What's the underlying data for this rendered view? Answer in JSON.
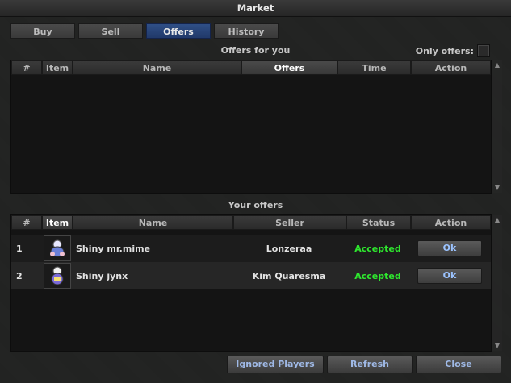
{
  "window": {
    "title": "Market"
  },
  "tabs": [
    {
      "label": "Buy",
      "active": false
    },
    {
      "label": "Sell",
      "active": false
    },
    {
      "label": "Offers",
      "active": true
    },
    {
      "label": "History",
      "active": false
    }
  ],
  "offers_for_you": {
    "title": "Offers for you",
    "only_offers_label": "Only offers:",
    "columns": [
      "#",
      "Item",
      "Name",
      "Offers",
      "Time",
      "Action"
    ],
    "selected_column": "Offers",
    "rows": []
  },
  "your_offers": {
    "title": "Your offers",
    "columns": [
      "#",
      "Item",
      "Name",
      "Seller",
      "Status",
      "Action"
    ],
    "selected_column": "Item",
    "rows": [
      {
        "num": "1",
        "name": "Shiny mr.mime",
        "seller": "Lonzeraa",
        "status": "Accepted",
        "action": "Ok"
      },
      {
        "num": "2",
        "name": "Shiny jynx",
        "seller": "Kim Quaresma",
        "status": "Accepted",
        "action": "Ok"
      }
    ]
  },
  "buttons": {
    "ignored_players": "Ignored Players",
    "refresh": "Refresh",
    "close": "Close"
  },
  "icons": {
    "item": "pokemon-item-icon",
    "scroll_up": "scroll-up-icon",
    "scroll_down": "scroll-down-icon"
  },
  "colors": {
    "active_tab": "#2f4f86",
    "status_accepted": "#2ee82e",
    "button_text": "#9fb9e6"
  }
}
